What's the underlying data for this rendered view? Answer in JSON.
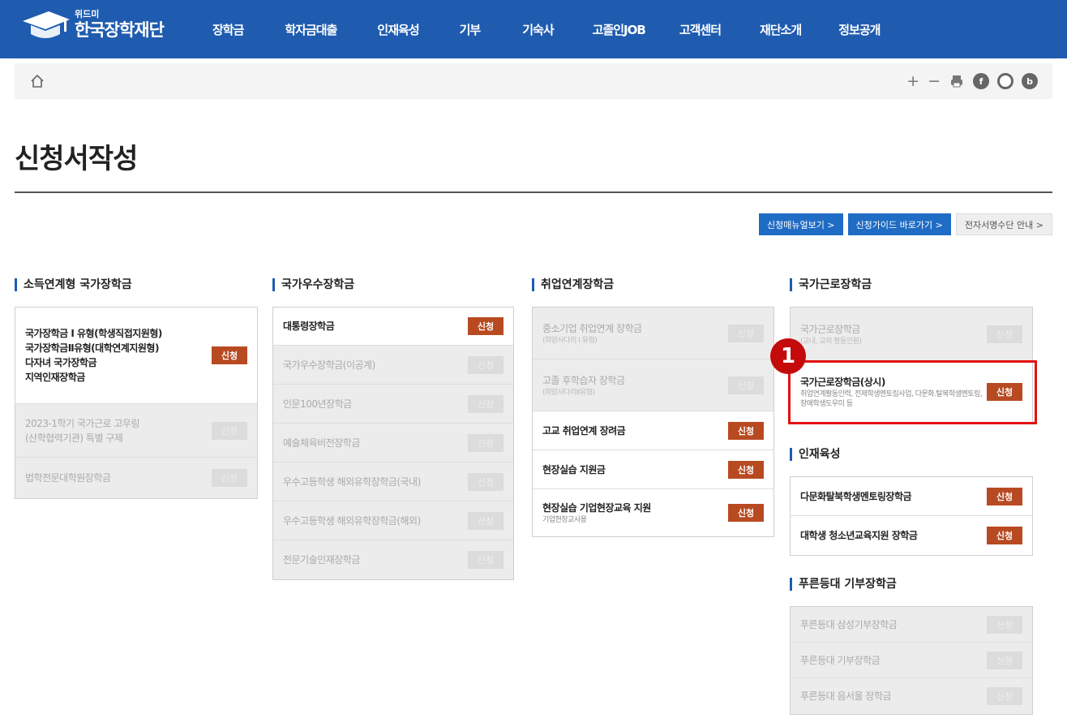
{
  "header": {
    "logo_small": "위드미",
    "logo_text": "한국장학재단",
    "menu": [
      "장학금",
      "학자금대출",
      "인재육성",
      "기부",
      "기숙사",
      "고졸인JOB",
      "고객센터",
      "재단소개",
      "정보공개"
    ]
  },
  "toolbar": {
    "tools": [
      "+",
      "−"
    ]
  },
  "page": {
    "title": "신청서작성"
  },
  "top_buttons": [
    "신청매뉴얼보기 >",
    "신청가이드 바로가기 >",
    "전자서명수단 안내 >"
  ],
  "apply_label": "신청",
  "columns": [
    {
      "title": "소득연계형 국가장학금",
      "items": [
        {
          "lines": [
            "국가장학금 I 유형(학생직접지원형)",
            "국가장학금Ⅱ유형(대학연계지원형)",
            "다자녀 국가장학금",
            "지역인재장학금"
          ],
          "sub": "",
          "enabled": true
        },
        {
          "lines": [
            "2023-1학기 국가근로 고우링",
            "(산학협력기관) 특별 구제"
          ],
          "sub": "",
          "enabled": false
        },
        {
          "lines": [
            "법학전문대학원장학금"
          ],
          "sub": "",
          "enabled": false
        }
      ]
    },
    {
      "title": "국가우수장학금",
      "items": [
        {
          "lines": [
            "대통령장학금"
          ],
          "sub": "",
          "enabled": true
        },
        {
          "lines": [
            "국가우수장학금(이공계)"
          ],
          "sub": "",
          "enabled": false
        },
        {
          "lines": [
            "인문100년장학금"
          ],
          "sub": "",
          "enabled": false
        },
        {
          "lines": [
            "예술체육비전장학금"
          ],
          "sub": "",
          "enabled": false
        },
        {
          "lines": [
            "우수고등학생 해외유학장학금(국내)"
          ],
          "sub": "",
          "enabled": false
        },
        {
          "lines": [
            "우수고등학생 해외유학장학금(해외)"
          ],
          "sub": "",
          "enabled": false
        },
        {
          "lines": [
            "전문기술인재장학금"
          ],
          "sub": "",
          "enabled": false
        }
      ]
    },
    {
      "title": "취업연계장학금",
      "items": [
        {
          "lines": [
            "중소기업 취업연계 장학금"
          ],
          "sub": "(희망사다리 I 유형)",
          "enabled": false
        },
        {
          "lines": [
            "고졸 후학습자 장학금"
          ],
          "sub": "(희망사다리Ⅱ유형)",
          "enabled": false
        },
        {
          "lines": [
            "고교 취업연계 장려금"
          ],
          "sub": "",
          "enabled": true
        },
        {
          "lines": [
            "현장실습 지원금"
          ],
          "sub": "",
          "enabled": true
        },
        {
          "lines": [
            "현장실습 기업현장교육 지원"
          ],
          "sub": "기업현장교사용",
          "enabled": true
        }
      ]
    },
    {
      "title": "국가근로장학금",
      "items": [
        {
          "lines": [
            "국가근로장학금"
          ],
          "sub": "(교내, 교외 활동인원)",
          "enabled": false
        },
        {
          "lines": [
            "국가근로장학금(상시)"
          ],
          "sub": "취업연계활동인력, 전제학생멘토링사업, 다문화.탈북학생멘토링, 장애학생도우미 등",
          "enabled": true
        }
      ]
    },
    {
      "title": "인재육성",
      "items": [
        {
          "lines": [
            "다문화탈북학생멘토링장학금"
          ],
          "sub": "",
          "enabled": true
        },
        {
          "lines": [
            "대학생 청소년교육지원 장학금"
          ],
          "sub": "",
          "enabled": true
        }
      ]
    },
    {
      "title": "푸른등대 기부장학금",
      "items": [
        {
          "lines": [
            "푸른등대 삼성기부장학금"
          ],
          "sub": "",
          "enabled": false
        },
        {
          "lines": [
            "푸른등대 기부장학금"
          ],
          "sub": "",
          "enabled": false
        },
        {
          "lines": [
            "푸른등대 음서울 장학금"
          ],
          "sub": "",
          "enabled": false
        }
      ]
    }
  ],
  "callout": {
    "number": "1"
  },
  "colors": {
    "header_bg": "#1f5cb0",
    "apply_button": "#b84a22",
    "disabled_bg": "#ececec",
    "highlight": "#e41111"
  }
}
